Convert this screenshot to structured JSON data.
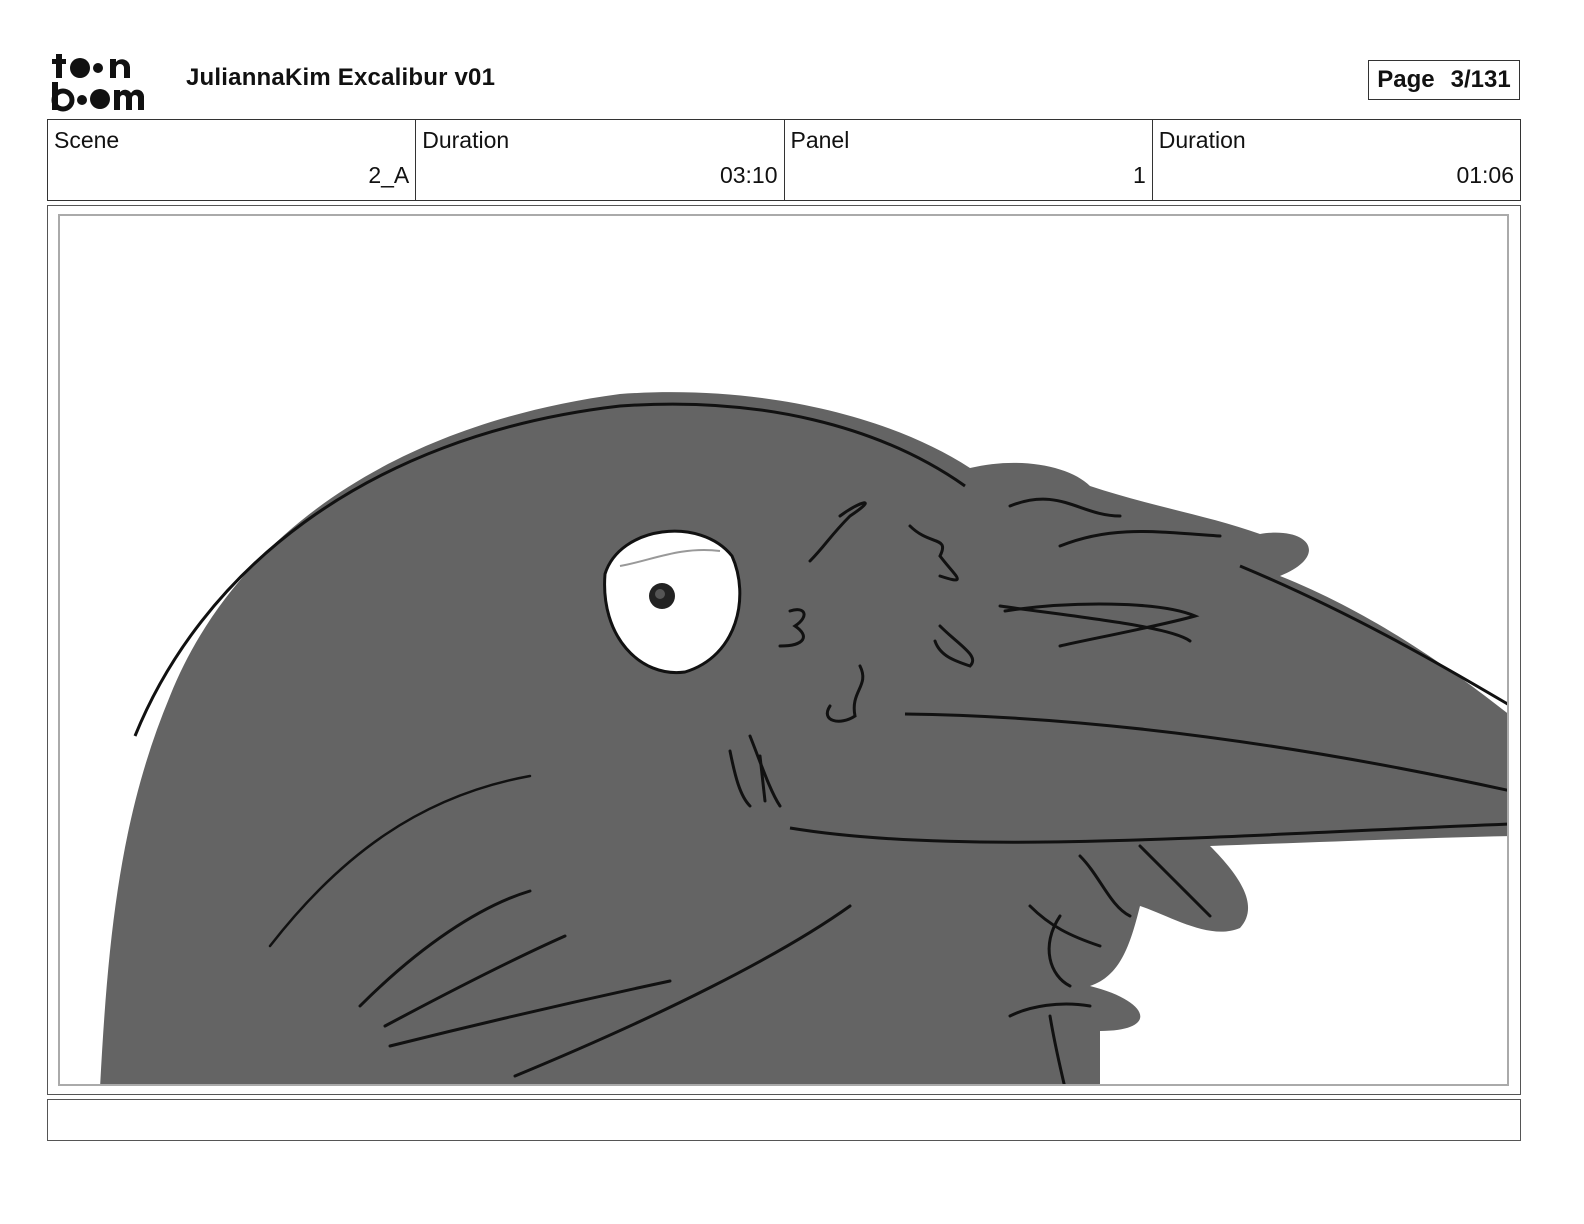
{
  "header": {
    "logo_text": "toon boom",
    "project_title": "JuliannaKim Excalibur v01",
    "page_label": "Page",
    "page_value": "3/131"
  },
  "info": {
    "scene_label": "Scene",
    "scene_value": "2_A",
    "scene_duration_label": "Duration",
    "scene_duration_value": "03:10",
    "panel_label": "Panel",
    "panel_value": "1",
    "panel_duration_label": "Duration",
    "panel_duration_value": "01:06"
  },
  "panel": {
    "image_subject": "raven-head-sketch",
    "fill_color": "#646464",
    "line_color": "#111111"
  },
  "caption": {
    "text": ""
  }
}
